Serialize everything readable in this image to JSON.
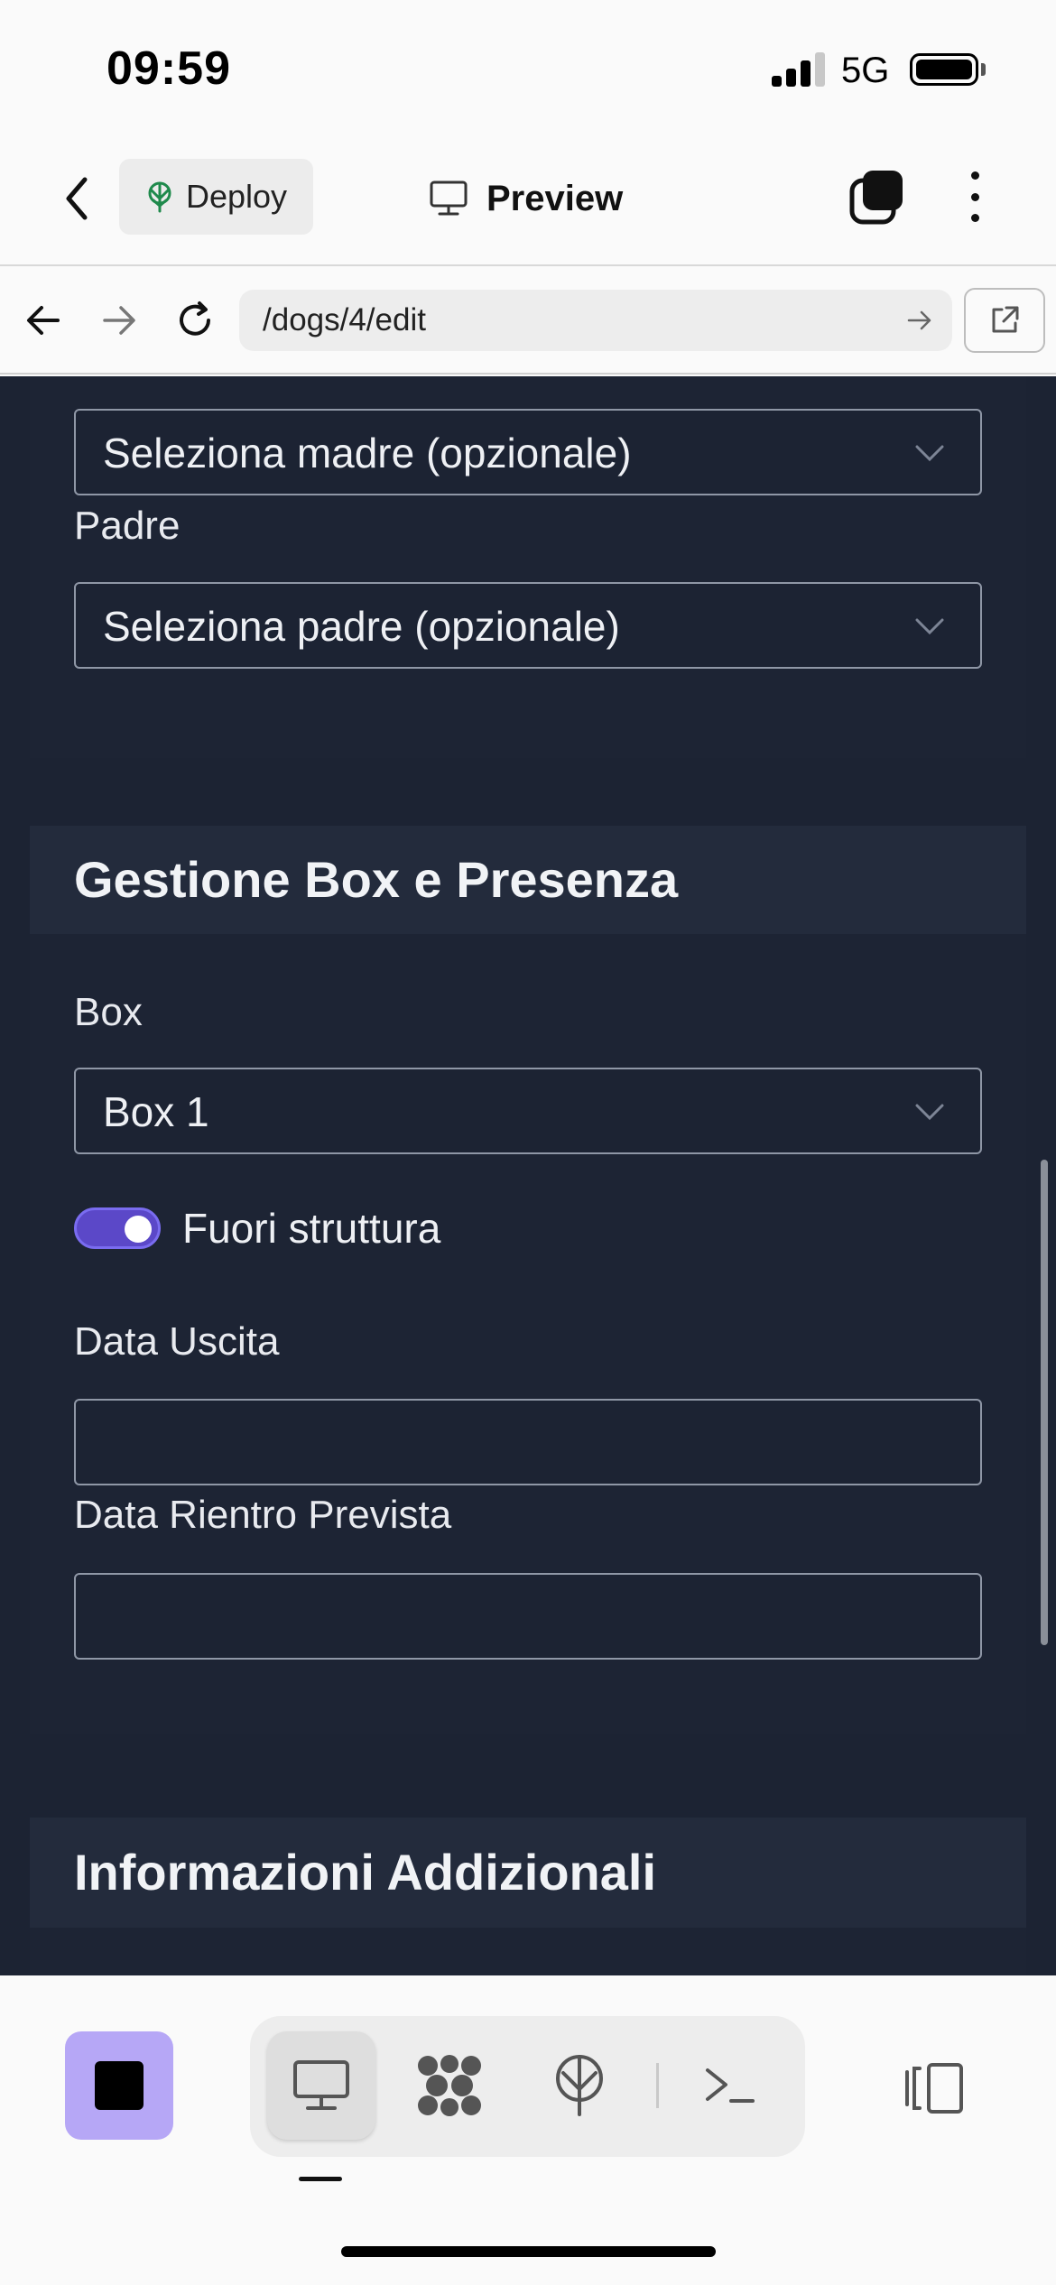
{
  "status_bar": {
    "time": "09:59",
    "network": "5G"
  },
  "toolbar": {
    "deploy_label": "Deploy",
    "preview_label": "Preview"
  },
  "browser": {
    "url": "/dogs/4/edit"
  },
  "form": {
    "madre_select": "Seleziona madre (opzionale)",
    "padre_label": "Padre",
    "padre_select": "Seleziona padre (opzionale)",
    "box_section_title": "Gestione Box e Presenza",
    "box_label": "Box",
    "box_select": "Box 1",
    "fuori_struttura_label": "Fuori struttura",
    "fuori_struttura_on": true,
    "data_uscita_label": "Data Uscita",
    "data_uscita_value": "",
    "data_rientro_label": "Data Rientro Prevista",
    "data_rientro_value": "",
    "info_section_title": "Informazioni Addizionali"
  },
  "colors": {
    "content_bg": "#1c2333",
    "section_header_bg": "#232b3c",
    "toggle_on": "#5b48c8",
    "stop_button": "#b6a7f6"
  },
  "icons": {
    "back": "chevron-left-icon",
    "deploy": "deploy-tree-icon",
    "preview": "monitor-icon",
    "tabs": "tabs-icon",
    "more": "more-vertical-icon",
    "nav_back": "arrow-left-icon",
    "nav_forward": "arrow-right-icon",
    "reload": "reload-icon",
    "external": "external-link-icon",
    "stop": "stop-icon",
    "bottom_tabs": [
      "monitor-icon",
      "agents-icon",
      "deploy-icon",
      "terminal-icon"
    ],
    "panel": "panel-icon"
  }
}
